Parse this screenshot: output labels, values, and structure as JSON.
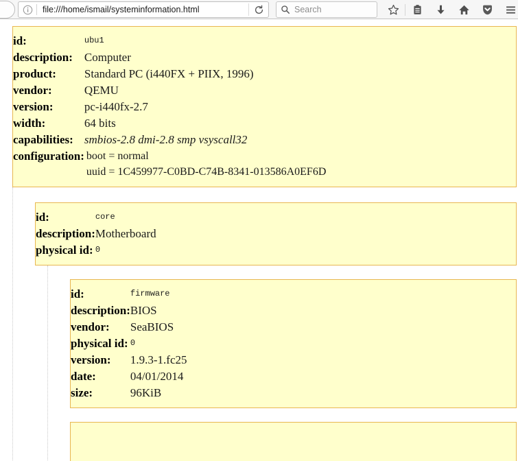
{
  "browser": {
    "back_button": "back-forward",
    "identity_icon": "info-icon",
    "url": "file:///home/ismail/systeminformation.html",
    "reload_icon": "reload-icon",
    "search_placeholder": "Search",
    "search_icon": "search-icon",
    "toolbar_icons": [
      {
        "name": "bookmark-star-icon",
        "label": "Bookmark"
      },
      {
        "name": "reader-list-icon",
        "label": "Reading list"
      },
      {
        "name": "downloads-icon",
        "label": "Downloads"
      },
      {
        "name": "home-icon",
        "label": "Home"
      },
      {
        "name": "pocket-icon",
        "label": "Pocket"
      },
      {
        "name": "hamburger-menu-icon",
        "label": "Open menu"
      }
    ]
  },
  "nodes": [
    {
      "node_name": "computer-node",
      "level": 0,
      "rows": [
        {
          "key": "id:",
          "value": "ubu1",
          "style": "mono"
        },
        {
          "key": "description:",
          "value": "Computer",
          "style": "serif"
        },
        {
          "key": "product:",
          "value": "Standard PC (i440FX + PIIX, 1996)",
          "style": "serif"
        },
        {
          "key": "vendor:",
          "value": "QEMU",
          "style": "serif"
        },
        {
          "key": "version:",
          "value": "pc-i440fx-2.7",
          "style": "serif"
        },
        {
          "key": "width:",
          "value": "64 bits",
          "style": "serif"
        },
        {
          "key": "capabilities:",
          "value": "smbios-2.8 dmi-2.8 smp vsyscall32",
          "style": "italic"
        },
        {
          "key": "configuration:",
          "style": "config",
          "lines": [
            "boot = normal",
            "uuid = 1C459977-C0BD-C74B-8341-013586A0EF6D"
          ]
        }
      ]
    },
    {
      "node_name": "motherboard-node",
      "level": 1,
      "rows": [
        {
          "key": "id:",
          "value": "core",
          "style": "mono"
        },
        {
          "key": "description:",
          "value": "Motherboard",
          "style": "serif"
        },
        {
          "key": "physical id:",
          "value": "0",
          "style": "mono"
        }
      ]
    },
    {
      "node_name": "bios-firmware-node",
      "level": 2,
      "rows": [
        {
          "key": "id:",
          "value": "firmware",
          "style": "mono"
        },
        {
          "key": "description:",
          "value": "BIOS",
          "style": "serif"
        },
        {
          "key": "vendor:",
          "value": "SeaBIOS",
          "style": "serif"
        },
        {
          "key": "physical id:",
          "value": "0",
          "style": "mono"
        },
        {
          "key": "version:",
          "value": "1.9.3-1.fc25",
          "style": "serif"
        },
        {
          "key": "date:",
          "value": "04/01/2014",
          "style": "serif"
        },
        {
          "key": "size:",
          "value": "96KiB",
          "style": "serif"
        }
      ]
    },
    {
      "node_name": "next-node-partial",
      "level": 2,
      "rows": []
    }
  ],
  "theme": {
    "node_background": "#ffffcc",
    "node_border": "#e8b650",
    "guide_line": "#c9c9c9",
    "page_background": "#ffffff"
  }
}
